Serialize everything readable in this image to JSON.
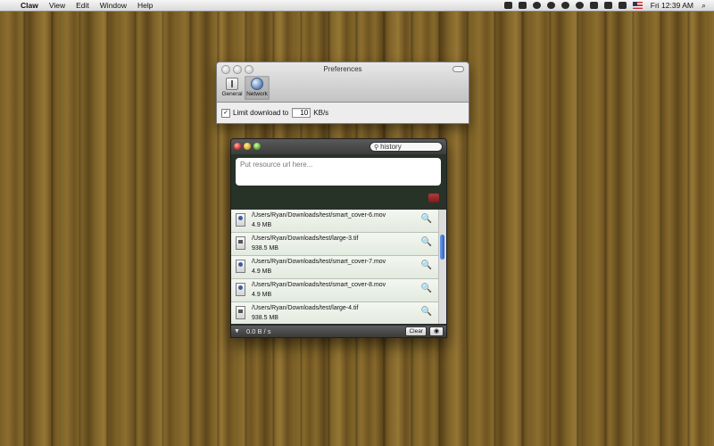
{
  "menubar": {
    "apple_glyph": "",
    "app_name": "Claw",
    "menus": [
      "View",
      "Edit",
      "Window",
      "Help"
    ],
    "status_icons": [
      "dropbox-icon",
      "evernote-icon",
      "cloud-icon",
      "sync-icon",
      "wifi-icon",
      "time-machine-icon",
      "screen-icon",
      "bluetooth-icon",
      "volume-icon",
      "flag-icon"
    ],
    "clock": "Fri 12:39 AM",
    "search_glyph": "⌕"
  },
  "preferences": {
    "title": "Preferences",
    "tabs": [
      {
        "label": "General",
        "icon": "general-icon",
        "selected": false
      },
      {
        "label": "Network",
        "icon": "network-icon",
        "selected": true
      }
    ],
    "limit_checked": true,
    "check_glyph": "✓",
    "limit_label": "Limit download to",
    "limit_value": "10",
    "unit": "KB/s"
  },
  "claw": {
    "search_value": "history",
    "search_glyph": "⚲",
    "url_placeholder": "Put resource url here...",
    "files": [
      {
        "path": "/Users/Ryan/Downloads/test/smart_cover-6.mov",
        "size": "4.9 MB",
        "type": "mov"
      },
      {
        "path": "/Users/Ryan/Downloads/test/large-3.tif",
        "size": "938.5 MB",
        "type": "tif"
      },
      {
        "path": "/Users/Ryan/Downloads/test/smart_cover-7.mov",
        "size": "4.9 MB",
        "type": "mov"
      },
      {
        "path": "/Users/Ryan/Downloads/test/smart_cover-8.mov",
        "size": "4.9 MB",
        "type": "mov"
      },
      {
        "path": "/Users/Ryan/Downloads/test/large-4.tif",
        "size": "938.5 MB",
        "type": "tif"
      }
    ],
    "reveal_glyph": "🔍",
    "footer": {
      "toggle_glyph": "▼",
      "speed": "0.0 B / s",
      "clear_label": "Clear",
      "eye_glyph": "◉"
    }
  }
}
